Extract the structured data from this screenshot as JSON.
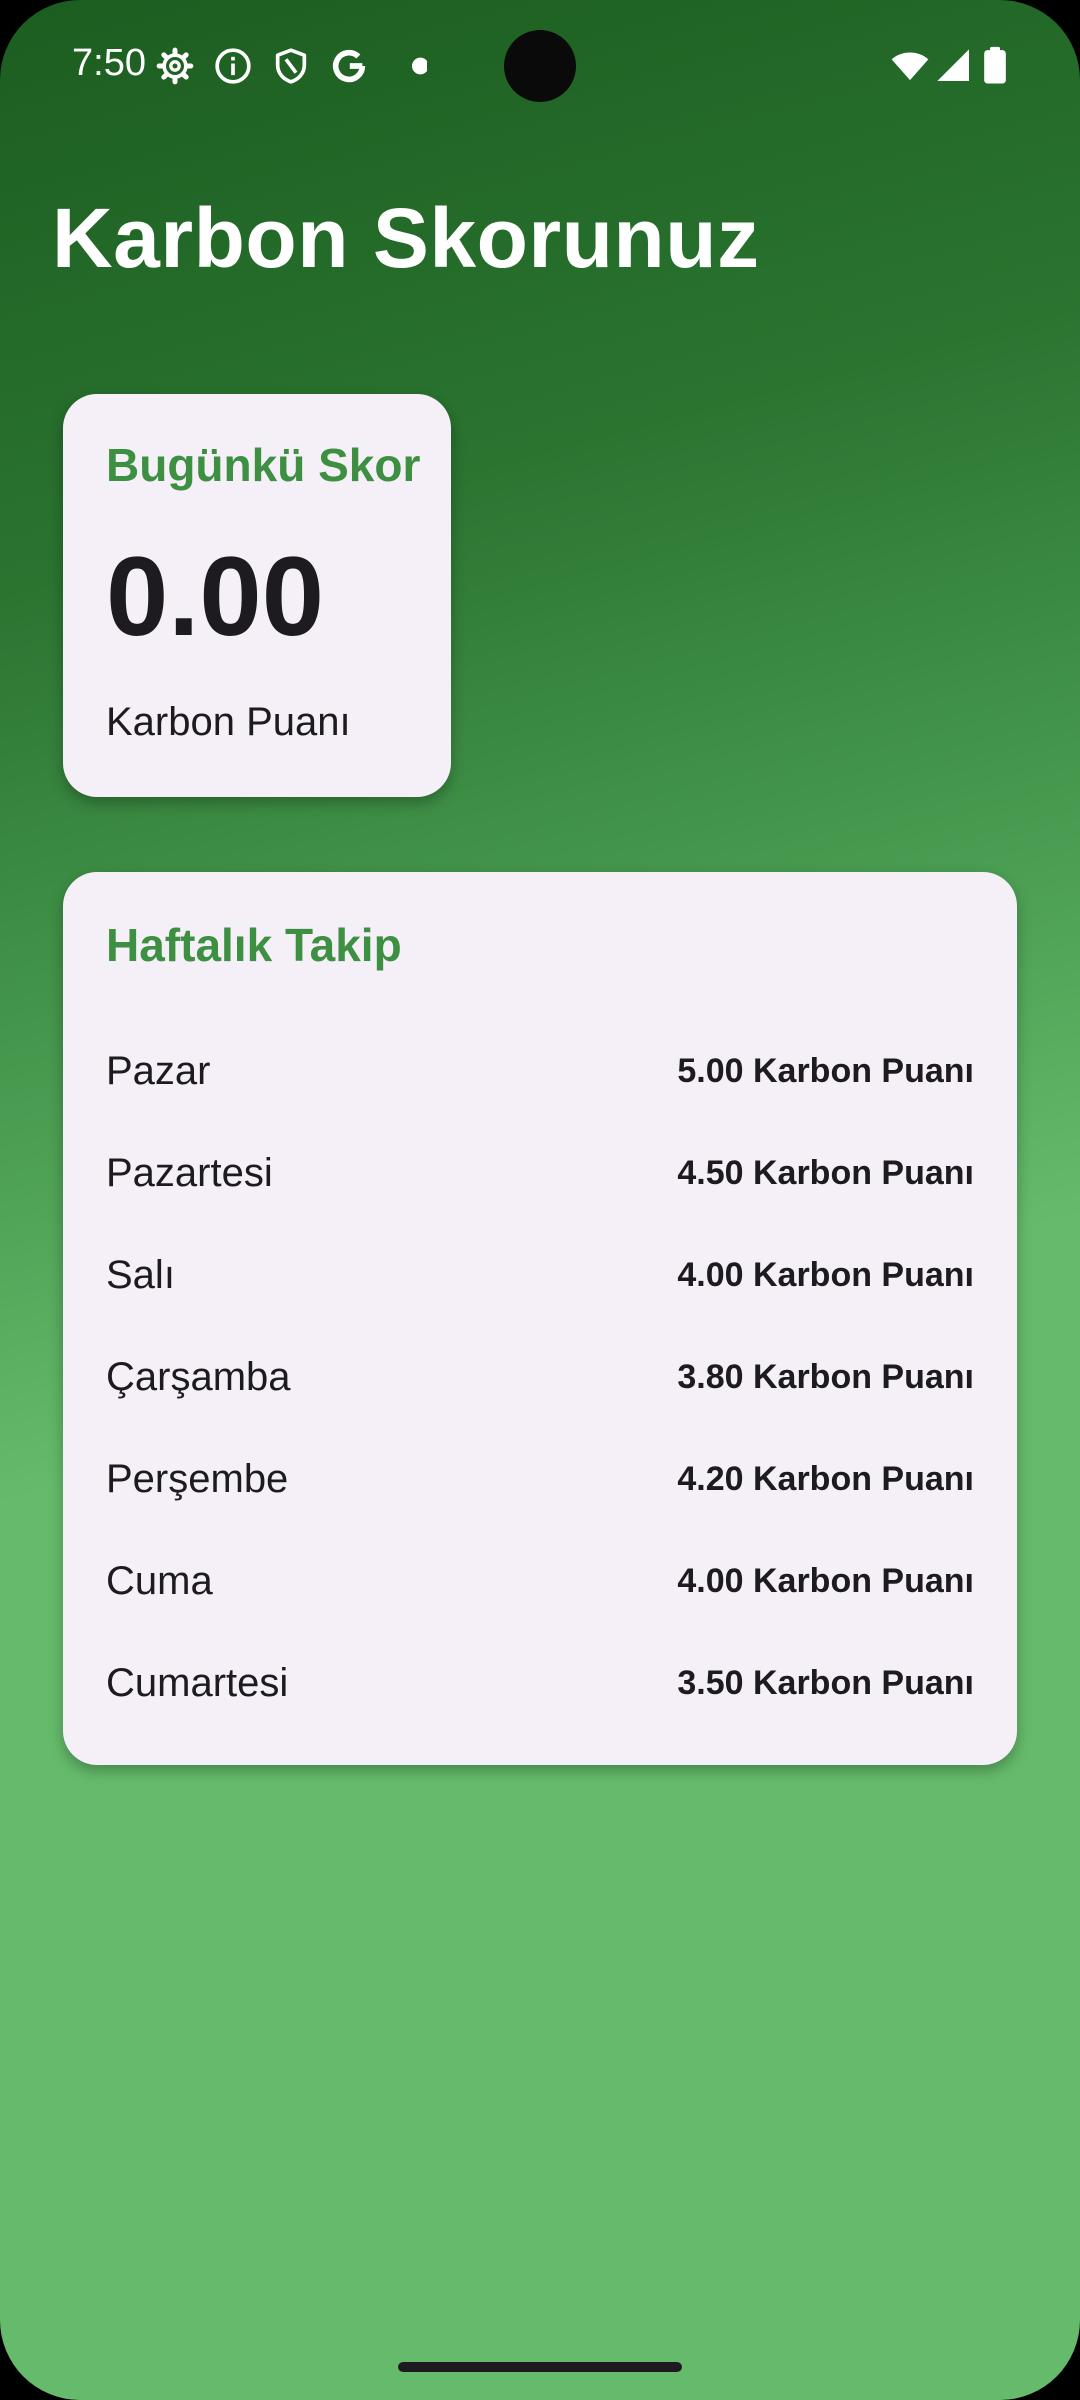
{
  "status_bar": {
    "time": "7:50",
    "icons": [
      "settings-icon",
      "info-icon",
      "shield-icon",
      "google-icon",
      "notification-dot-icon",
      "wifi-icon",
      "signal-icon",
      "battery-icon"
    ]
  },
  "header": {
    "title": "Karbon Skorunuz"
  },
  "today_card": {
    "heading": "Bugünkü Skor",
    "score": "0.00",
    "unit": "Karbon Puanı"
  },
  "weekly_card": {
    "heading": "Haftalık Takip",
    "days": [
      {
        "day": "Pazar",
        "score": "5.00 Karbon Puanı"
      },
      {
        "day": "Pazartesi",
        "score": "4.50 Karbon Puanı"
      },
      {
        "day": "Salı",
        "score": "4.00 Karbon Puanı"
      },
      {
        "day": "Çarşamba",
        "score": "3.80 Karbon Puanı"
      },
      {
        "day": "Perşembe",
        "score": "4.20 Karbon Puanı"
      },
      {
        "day": "Cuma",
        "score": "4.00 Karbon Puanı"
      },
      {
        "day": "Cumartesi",
        "score": "3.50 Karbon Puanı"
      }
    ]
  },
  "colors": {
    "accent_green": "#3d8f41",
    "card_background": "#f5eff7",
    "gradient_top": "#1c5d20",
    "gradient_bottom": "#65bb6b"
  }
}
